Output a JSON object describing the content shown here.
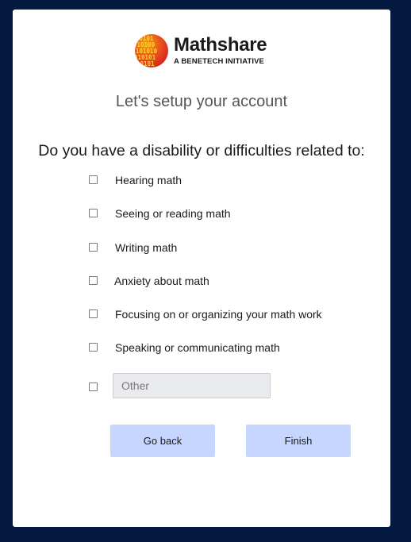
{
  "brand": {
    "name": "Mathshare",
    "tagline": "A BENETECH INITIATIVE",
    "logo_icon": "binary-digits-circle-icon",
    "logo_colors": [
      "#f7a400",
      "#e8531c",
      "#d8241f"
    ]
  },
  "setup": {
    "title": "Let's setup your account",
    "question": "Do you have a disability or difficulties related to:"
  },
  "options": [
    {
      "label": "Hearing math",
      "checked": false
    },
    {
      "label": "Seeing or reading math",
      "checked": false
    },
    {
      "label": "Writing math",
      "checked": false
    },
    {
      "label": "Anxiety about math",
      "checked": false
    },
    {
      "label": "Focusing on or organizing your math work",
      "checked": false
    },
    {
      "label": "Speaking or communicating math",
      "checked": false
    }
  ],
  "other": {
    "checked": false,
    "placeholder": "Other",
    "value": ""
  },
  "buttons": {
    "back_label": "Go back",
    "finish_label": "Finish",
    "color": "#c6d6ff"
  },
  "colors": {
    "background": "#051a40",
    "card": "#ffffff"
  }
}
